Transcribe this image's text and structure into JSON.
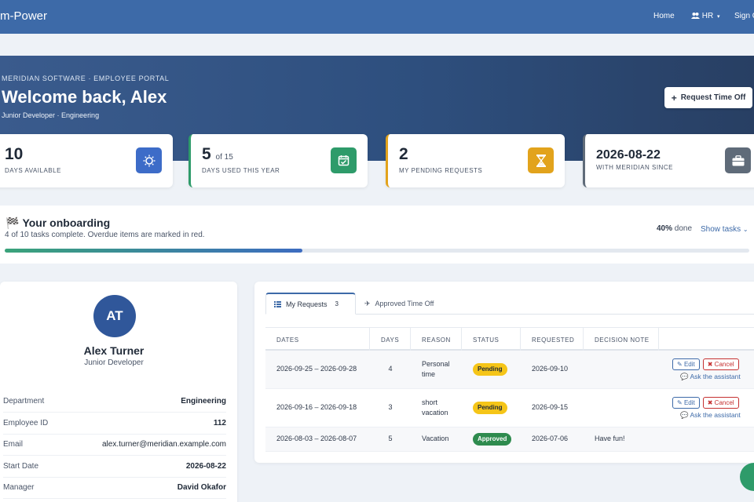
{
  "navbar": {
    "brand": "m-Power",
    "home": "Home",
    "hr": "HR",
    "sign": "Sign O"
  },
  "hero": {
    "eyebrow": "MERIDIAN SOFTWARE · EMPLOYEE PORTAL",
    "title": "Welcome back, Alex",
    "subtitle": "Junior Developer · Engineering",
    "request_button": "Request Time Off"
  },
  "stats": [
    {
      "value": "10",
      "label": "DAYS AVAILABLE",
      "icon": "sun-icon",
      "color": "#3d6cc8"
    },
    {
      "value": "5",
      "of": "of 15",
      "label": "DAYS USED THIS YEAR",
      "icon": "calendar-check-icon",
      "color": "#2e9b6a"
    },
    {
      "value": "2",
      "label": "MY PENDING REQUESTS",
      "icon": "hourglass-icon",
      "color": "#e2a31c"
    },
    {
      "value": "2026-08-22",
      "label": "WITH MERIDIAN SINCE",
      "icon": "briefcase-icon",
      "color": "#5f6b79"
    }
  ],
  "onboarding": {
    "title": "Your onboarding",
    "subtitle": "4 of 10 tasks complete. Overdue items are marked in red.",
    "percent_label": "40%",
    "done_label": "done",
    "show_tasks": "Show tasks",
    "progress": 0.4
  },
  "profile": {
    "initials": "AT",
    "name": "Alex Turner",
    "role": "Junior Developer",
    "rows": [
      {
        "key": "Department",
        "value": "Engineering"
      },
      {
        "key": "Employee ID",
        "value": "112"
      },
      {
        "key": "Email",
        "value": "alex.turner@meridian.example.com"
      },
      {
        "key": "Start Date",
        "value": "2026-08-22"
      },
      {
        "key": "Manager",
        "value": "David Okafor"
      }
    ]
  },
  "requests": {
    "tabs": {
      "my_requests": "My Requests",
      "count": "3",
      "approved": "Approved Time Off"
    },
    "columns": [
      "DATES",
      "DAYS",
      "REASON",
      "STATUS",
      "REQUESTED",
      "DECISION NOTE"
    ],
    "rows": [
      {
        "dates": "2026-09-25 – 2026-09-28",
        "days": "4",
        "reason": "Personal time",
        "status": "Pending",
        "requested": "2026-09-10",
        "note": ""
      },
      {
        "dates": "2026-09-16 – 2026-09-18",
        "days": "3",
        "reason": "short vacation",
        "status": "Pending",
        "requested": "2026-09-15",
        "note": ""
      },
      {
        "dates": "2026-08-03 – 2026-08-07",
        "days": "5",
        "reason": "Vacation",
        "status": "Approved",
        "requested": "2026-07-06",
        "note": "Have fun!"
      }
    ],
    "edit_label": "Edit",
    "cancel_label": "Cancel",
    "ask_label": "Ask the assistant"
  }
}
